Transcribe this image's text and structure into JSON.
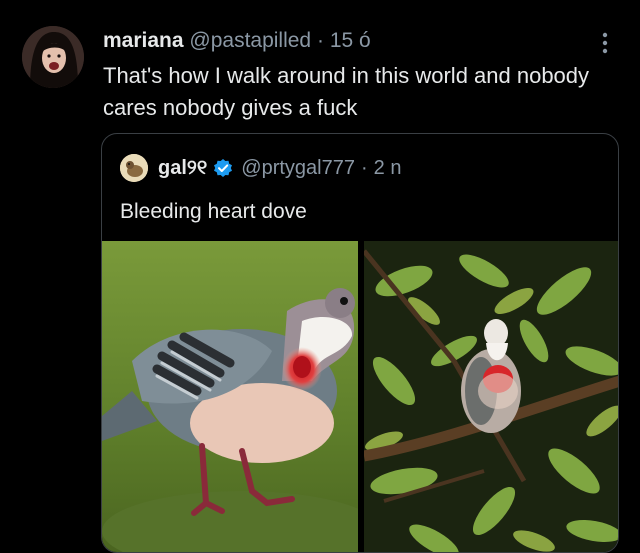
{
  "post": {
    "author_name": "mariana",
    "author_handle": "@pastapilled",
    "separator": "·",
    "time": "15 ó",
    "text": "That's how I walk around in this world and nobody cares nobody gives a fuck",
    "more_icon": "more-vertical-icon"
  },
  "quoted_post": {
    "author_name": "gal୨୧",
    "verified_icon": "verified-badge-icon",
    "verified_color": "#1d9bf0",
    "author_handle": "@prtygal777",
    "separator": "·",
    "time": "2 n",
    "text": "Bleeding heart dove",
    "images": [
      "bleeding-heart-dove-closeup",
      "bleeding-heart-dove-in-branches"
    ]
  },
  "colors": {
    "background": "#000000",
    "primary_text": "#e7e9ea",
    "secondary_text": "#8b98a5",
    "border": "#3a3f44"
  }
}
